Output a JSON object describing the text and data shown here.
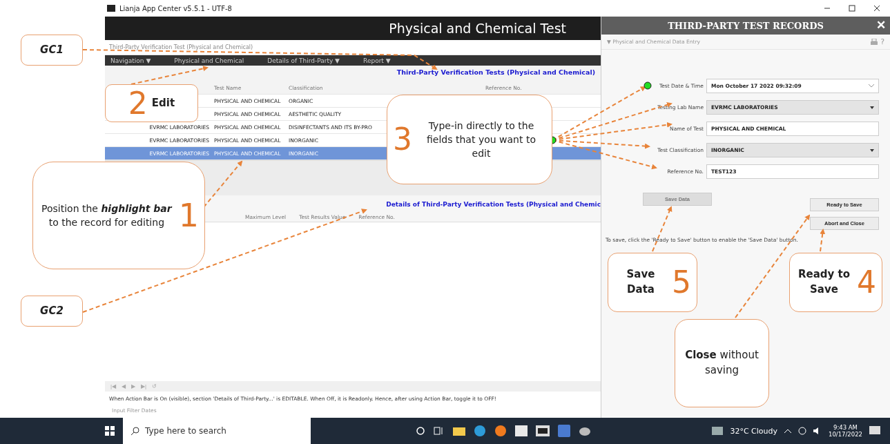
{
  "window": {
    "title": "Lianja App Center v5.5.1 - UTF-8"
  },
  "app": {
    "header": "Physical and Chemical Test",
    "breadcrumb": "Third-Party Verification Test (Physical and Chemical)",
    "menu": [
      {
        "label": "Navigation ▼"
      },
      {
        "label": "Physical and Chemical"
      },
      {
        "label": "Details of Third-Party ▼"
      },
      {
        "label": "Report ▼"
      }
    ],
    "section_title": "Third-Party Verification Tests (Physical and Chemical)",
    "table": {
      "columns": [
        "Test Name",
        "Classification",
        "Reference No."
      ],
      "rows": [
        {
          "test_name": "PHYSICAL AND CHEMICAL",
          "classification": "ORGANIC",
          "selected": false
        },
        {
          "test_name": "PHYSICAL AND CHEMICAL",
          "classification": "AESTHETIC QUALITY",
          "selected": false
        },
        {
          "lab": "EVRMC LABORATORIES",
          "test_name": "PHYSICAL AND CHEMICAL",
          "classification": "DISINFECTANTS AND ITS BY-PRO",
          "selected": false
        },
        {
          "lab": "EVRMC LABORATORIES",
          "test_name": "PHYSICAL AND CHEMICAL",
          "classification": "INORGANIC",
          "selected": false
        },
        {
          "lab": "EVRMC LABORATORIES",
          "test_name": "PHYSICAL AND CHEMICAL",
          "classification": "INORGANIC",
          "selected": true
        }
      ]
    },
    "details_title": "Details of Third-Party Verification Tests (Physical and Chemic",
    "details_columns": [
      "Maximum Level",
      "Test Results Value",
      "Reference No."
    ],
    "nav_buttons": [
      "|◀",
      "◀",
      "▶",
      "▶|",
      "↺"
    ],
    "note": "When Action Bar is On (visible), section 'Details of Third-Party...' is EDITABLE. When Off, it is Readonly. Hence, after using Action Bar, toggle it to OFF!",
    "filter_label": "Input Filter Dates"
  },
  "panel": {
    "title": "THIRD-PARTY TEST RECORDS",
    "close": "✕",
    "section": "▼ Physical and Chemical Data Entry",
    "help": "?",
    "fields": [
      {
        "label": "Test Date & Time",
        "value": "Mon October 17 2022 09:32:09",
        "kind": "date"
      },
      {
        "label": "Testing Lab Name",
        "value": "EVRMC LABORATORIES",
        "kind": "combo"
      },
      {
        "label": "Name of Test",
        "value": "PHYSICAL AND CHEMICAL",
        "kind": "text"
      },
      {
        "label": "Test Classification",
        "value": "INORGANIC",
        "kind": "combo"
      },
      {
        "label": "Reference No.",
        "value": "TEST123",
        "kind": "text"
      }
    ],
    "save_button": {
      "label": "Save Data",
      "disabled": true
    },
    "ready_button": {
      "label": "Ready to Save"
    },
    "abort_button": {
      "label": "Abort and Close"
    },
    "hint": "To save, click the 'Ready to Save' button to enable the 'Save Data' button."
  },
  "callouts": [
    {
      "kind": "tag",
      "text": "GC1"
    },
    {
      "kind": "tag",
      "text": "GC2"
    },
    {
      "kind": "step",
      "number": "2",
      "text": "**Edit**"
    },
    {
      "kind": "step",
      "number": "1",
      "text": "Position the *highlight bar* to the record for editing"
    },
    {
      "kind": "step",
      "number": "3",
      "text": "Type-in directly to the fields that you want to edit"
    },
    {
      "kind": "step",
      "number": "5",
      "text": "**Save Data**"
    },
    {
      "kind": "step",
      "number": "4",
      "text": "**Ready to Save**"
    },
    {
      "kind": "note",
      "text": "**Close** without saving"
    }
  ],
  "taskbar": {
    "search_placeholder": "Type here to search",
    "weather": "32°C  Cloudy",
    "time": "9:43 AM",
    "date": "10/17/2022"
  }
}
